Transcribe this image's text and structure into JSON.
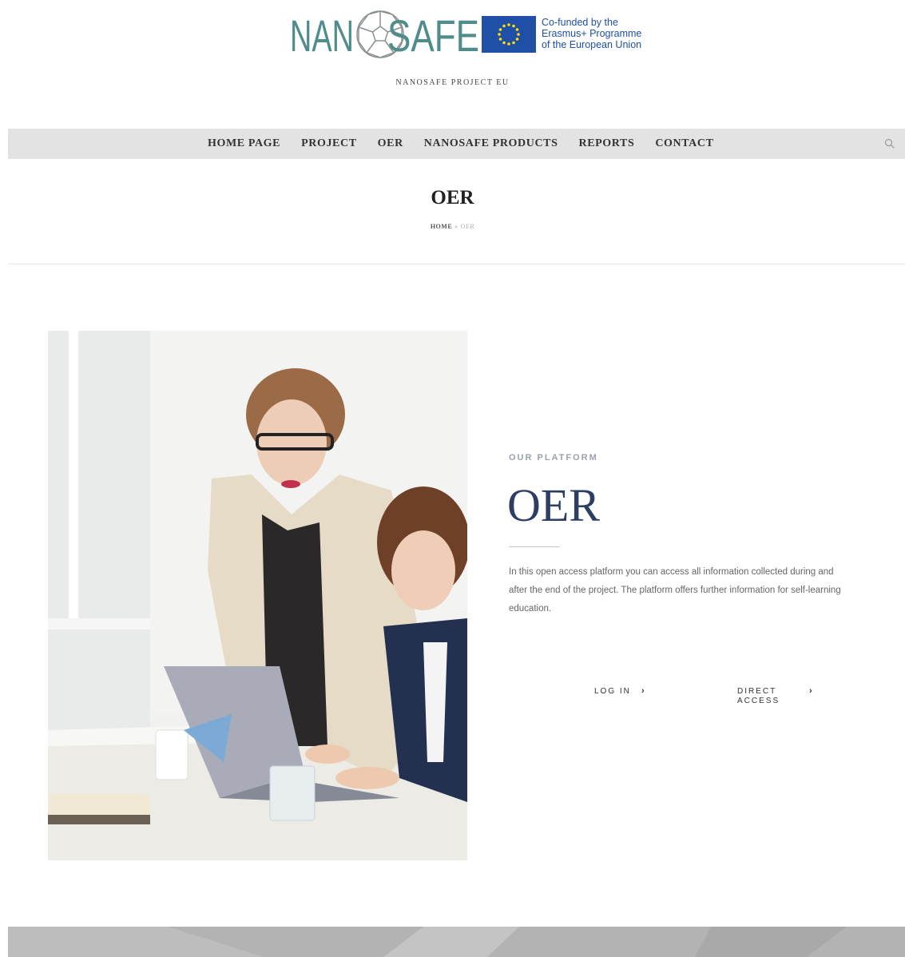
{
  "brand": {
    "logo_word": "NANOSAFE",
    "eu_caption": "Co-funded by the\nErasmus+ Programme\nof the European Union",
    "site_name": "NANOSAFE PROJECT EU"
  },
  "nav": {
    "items": [
      {
        "label": "HOME PAGE"
      },
      {
        "label": "PROJECT"
      },
      {
        "label": "OER"
      },
      {
        "label": "NANOSAFE PRODUCTS"
      },
      {
        "label": "REPORTS"
      },
      {
        "label": "CONTACT"
      }
    ],
    "search_icon": "search-icon"
  },
  "page": {
    "title": "OER",
    "breadcrumb": {
      "home": "HOME",
      "separator": "»",
      "current": "OER"
    }
  },
  "platform": {
    "eyebrow": "OUR PLATFORM",
    "title": "OER",
    "description": "In this open access platform you can access all information collected during and after the end of the project. The platform offers further information for self-learning education.",
    "login_label": "LOG IN",
    "direct_label_1": "DIRECT",
    "direct_label_2": "ACCESS",
    "chevron": "›"
  },
  "colors": {
    "logo_teal": "#4f8c8a",
    "eu_blue": "#1f4fa6",
    "title_navy": "#2d3e63",
    "nav_bg": "#e3e3e3"
  }
}
